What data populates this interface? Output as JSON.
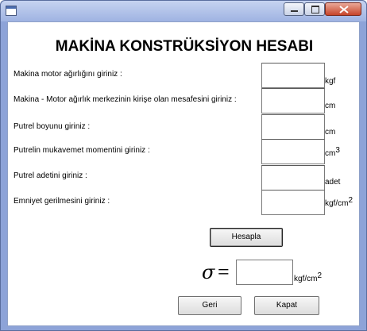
{
  "window": {
    "title": ""
  },
  "form": {
    "title": "MAKİNA KONSTRÜKSİYON HESABI",
    "fields": [
      {
        "label": "Makina motor ağırlığını giriniz :",
        "value": "",
        "unit": "kgf",
        "unit_sup": ""
      },
      {
        "label": "Makina - Motor ağırlık merkezinin kirişe olan mesafesini giriniz :",
        "value": "",
        "unit": "cm",
        "unit_sup": ""
      },
      {
        "label": "Putrel boyunu giriniz :",
        "value": "",
        "unit": "cm",
        "unit_sup": ""
      },
      {
        "label": "Putrelin mukavemet momentini giriniz :",
        "value": "",
        "unit": "cm",
        "unit_sup": "3"
      },
      {
        "label": "Putrel adetini giriniz :",
        "value": "",
        "unit": "adet",
        "unit_sup": ""
      },
      {
        "label": "Emniyet gerilmesini giriniz :",
        "value": "",
        "unit": "kgf/cm",
        "unit_sup": "2"
      }
    ],
    "calculate_label": "Hesapla",
    "result": {
      "symbol": "σ",
      "equals": "=",
      "value": "",
      "unit": "kgf/cm",
      "unit_sup": "2"
    },
    "back_label": "Geri",
    "close_label": "Kapat"
  }
}
